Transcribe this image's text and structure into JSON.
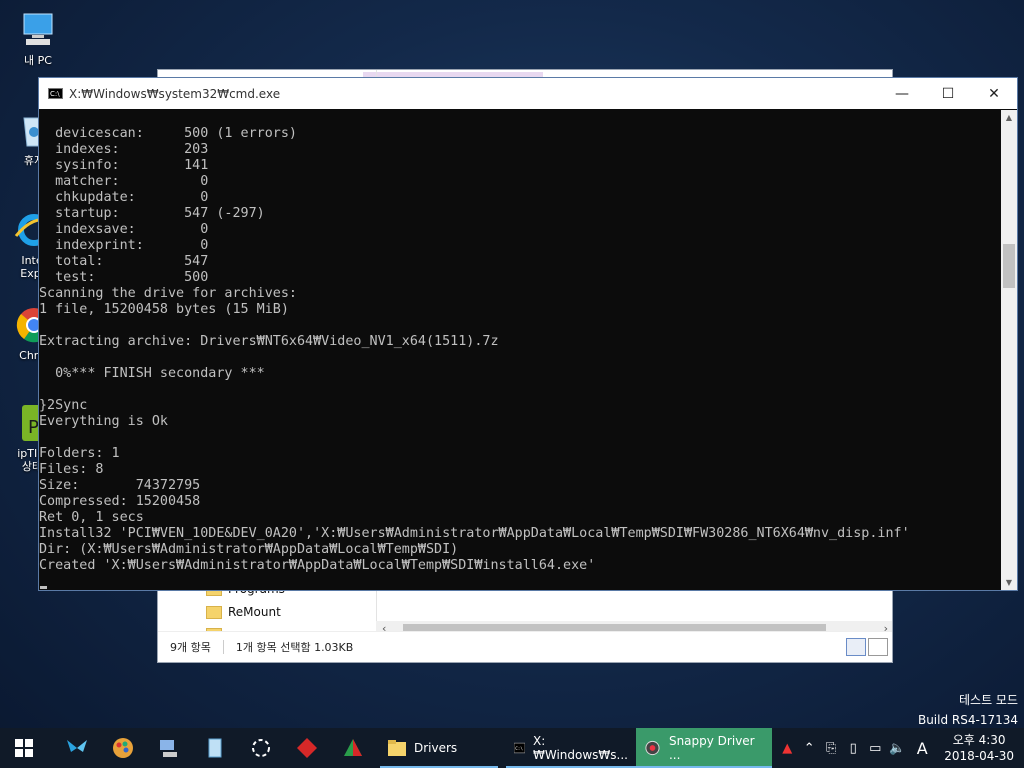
{
  "desktop": {
    "icons": [
      {
        "label": "내 PC",
        "name": "my-pc"
      },
      {
        "label": "휴지",
        "name": "recycle-bin"
      },
      {
        "label": "Inte\nExpl",
        "name": "internet-explorer"
      },
      {
        "label": "Chro",
        "name": "chrome"
      },
      {
        "label": "ipTIM\n상태",
        "name": "iptime-status"
      }
    ]
  },
  "explorer": {
    "nav_items": [
      "Programs",
      "ReMount",
      "song"
    ],
    "status_items": "9개 항목",
    "status_selected": "1개 항목 선택함 1.03KB"
  },
  "cmd": {
    "title": "X:₩Windows₩system32₩cmd.exe",
    "lines": [
      "  devicescan:     500 (1 errors)",
      "  indexes:        203",
      "  sysinfo:        141",
      "  matcher:          0",
      "  chkupdate:        0",
      "  startup:        547 (-297)",
      "  indexsave:        0",
      "  indexprint:       0",
      "  total:          547",
      "  test:           500",
      "Scanning the drive for archives:",
      "1 file, 15200458 bytes (15 MiB)",
      "",
      "Extracting archive: Drivers₩NT6x64₩Video_NV1_x64(1511).7z",
      "",
      "  0%*** FINISH secondary ***",
      "",
      "}2Sync",
      "Everything is Ok",
      "",
      "Folders: 1",
      "Files: 8",
      "Size:       74372795",
      "Compressed: 15200458",
      "Ret 0, 1 secs",
      "Install32 'PCI₩VEN_10DE&DEV_0A20','X:₩Users₩Administrator₩AppData₩Local₩Temp₩SDI₩FW30286_NT6X64₩nv_disp.inf'",
      "Dir: (X:₩Users₩Administrator₩AppData₩Local₩Temp₩SDI)",
      "Created 'X:₩Users₩Administrator₩AppData₩Local₩Temp₩SDI₩install64.exe'"
    ]
  },
  "watermark": {
    "line1": "테스트 모드",
    "line2": "Build RS4-17134"
  },
  "taskbar": {
    "apps": [
      {
        "label": "Drivers",
        "name": "taskbar-explorer-drivers"
      },
      {
        "label": "X:₩Windows₩s...",
        "name": "taskbar-cmd"
      },
      {
        "label": "Snappy Driver ...",
        "name": "taskbar-snappy-driver"
      }
    ],
    "ime": "A",
    "clock_time": "오후 4:30",
    "clock_date": "2018-04-30",
    "active_color": "#3a9a6a"
  }
}
